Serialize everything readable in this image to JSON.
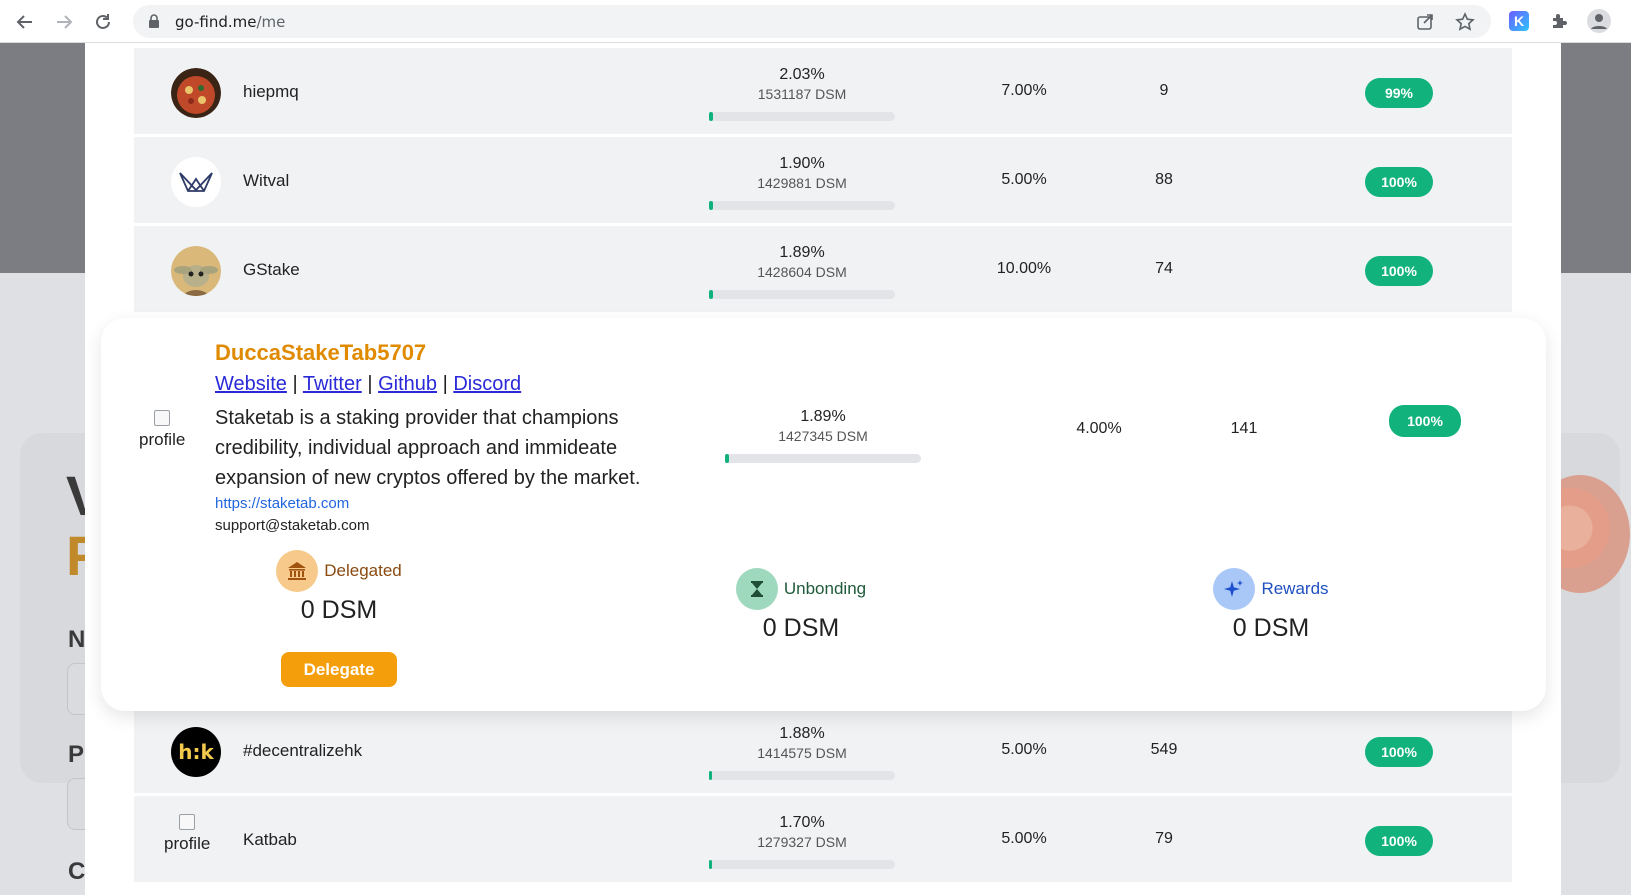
{
  "browser": {
    "url_host": "go-find.me",
    "url_path": "/me",
    "extension_label": "K"
  },
  "backdrop": {
    "letters": [
      "V",
      "F",
      "N",
      "P",
      "C"
    ]
  },
  "validators": [
    {
      "name": "hiepmq",
      "avatar": "pizza-avatar",
      "stake_pct": "2.03%",
      "stake_amount": "1531187 DSM",
      "stake_fraction": 0.0203,
      "commission": "7.00%",
      "delegators": "9",
      "uptime": "99%"
    },
    {
      "name": "Witval",
      "avatar": "witval-logo",
      "stake_pct": "1.90%",
      "stake_amount": "1429881 DSM",
      "stake_fraction": 0.019,
      "commission": "5.00%",
      "delegators": "88",
      "uptime": "100%"
    },
    {
      "name": "GStake",
      "avatar": "baby-yoda-avatar",
      "stake_pct": "1.89%",
      "stake_amount": "1428604 DSM",
      "stake_fraction": 0.0189,
      "commission": "10.00%",
      "delegators": "74",
      "uptime": "100%"
    }
  ],
  "expanded": {
    "alt_text": "profile",
    "name": "DuccaStakeTab5707",
    "links": [
      "Website",
      "Twitter",
      "Github",
      "Discord"
    ],
    "separator": "|",
    "description": "Staketab is a staking provider that champions credibility, individual approach and immideate expansion of new cryptos offered by the market.",
    "website": "https://staketab.com",
    "email": "support@staketab.com",
    "stake_pct": "1.89%",
    "stake_amount": "1427345 DSM",
    "stake_fraction": 0.0189,
    "commission": "4.00%",
    "delegators": "141",
    "uptime": "100%",
    "delegated_label": "Delegated",
    "delegated_value": "0 DSM",
    "unbonding_label": "Unbonding",
    "unbonding_value": "0 DSM",
    "rewards_label": "Rewards",
    "rewards_value": "0 DSM",
    "delegate_button": "Delegate"
  },
  "validators_after": [
    {
      "name": "#decentralizehk",
      "avatar": "hk-logo",
      "avatar_text": "h:k",
      "stake_pct": "1.88%",
      "stake_amount": "1414575 DSM",
      "stake_fraction": 0.0188,
      "commission": "5.00%",
      "delegators": "549",
      "uptime": "100%"
    },
    {
      "name": "Katbab",
      "avatar": "broken-image",
      "alt_text": "profile",
      "stake_pct": "1.70%",
      "stake_amount": "1279327 DSM",
      "stake_fraction": 0.017,
      "commission": "5.00%",
      "delegators": "79",
      "uptime": "100%"
    }
  ],
  "colors": {
    "accent_orange": "#e08a00",
    "uptime_green": "#11b27c",
    "link_blue": "#2a2ad8",
    "delegate_button": "#f59e0b"
  }
}
